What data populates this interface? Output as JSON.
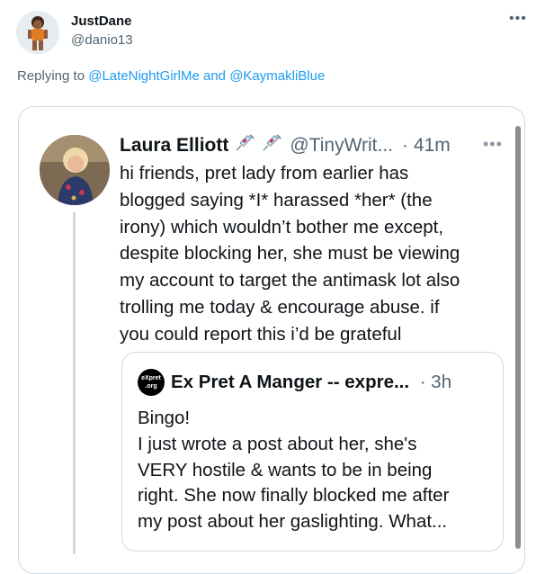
{
  "reply_tweet": {
    "display_name": "JustDane",
    "handle": "@danio13",
    "more_icon": "ellipsis-icon",
    "replying_prefix": "Replying to",
    "reply_to_1": "@LateNightGirlMe",
    "reply_joiner": "and",
    "reply_to_2": "@KaymakliBlue"
  },
  "embedded_tweet": {
    "display_name": "Laura Elliott",
    "name_emojis": [
      "syringe-icon",
      "syringe-icon"
    ],
    "handle": "@TinyWrit...",
    "time": "· 41m",
    "more_icon": "ellipsis-icon",
    "text": "hi friends, pret lady from earlier has\nblogged saying *I* harassed *her* (the\nirony) which wouldn’t bother me except,\ndespite blocking her, she must be viewing\nmy account to target the antimask lot also\ntrolling me today & encourage abuse. if\nyou could report this i’d be grateful"
  },
  "quoted_tweet": {
    "avatar_line1": "eXpret",
    "avatar_line2": ".org",
    "display_name": "Ex Pret A Manger -- expre...",
    "time": "· 3h",
    "text": "Bingo!\nI just wrote a post about her, she's\nVERY hostile & wants to be in being\nright. She now finally blocked me after\nmy post about her gaslighting. What..."
  },
  "colors": {
    "link": "#1d9bf0",
    "secondary_text": "#536471",
    "border": "#cfd9de"
  }
}
